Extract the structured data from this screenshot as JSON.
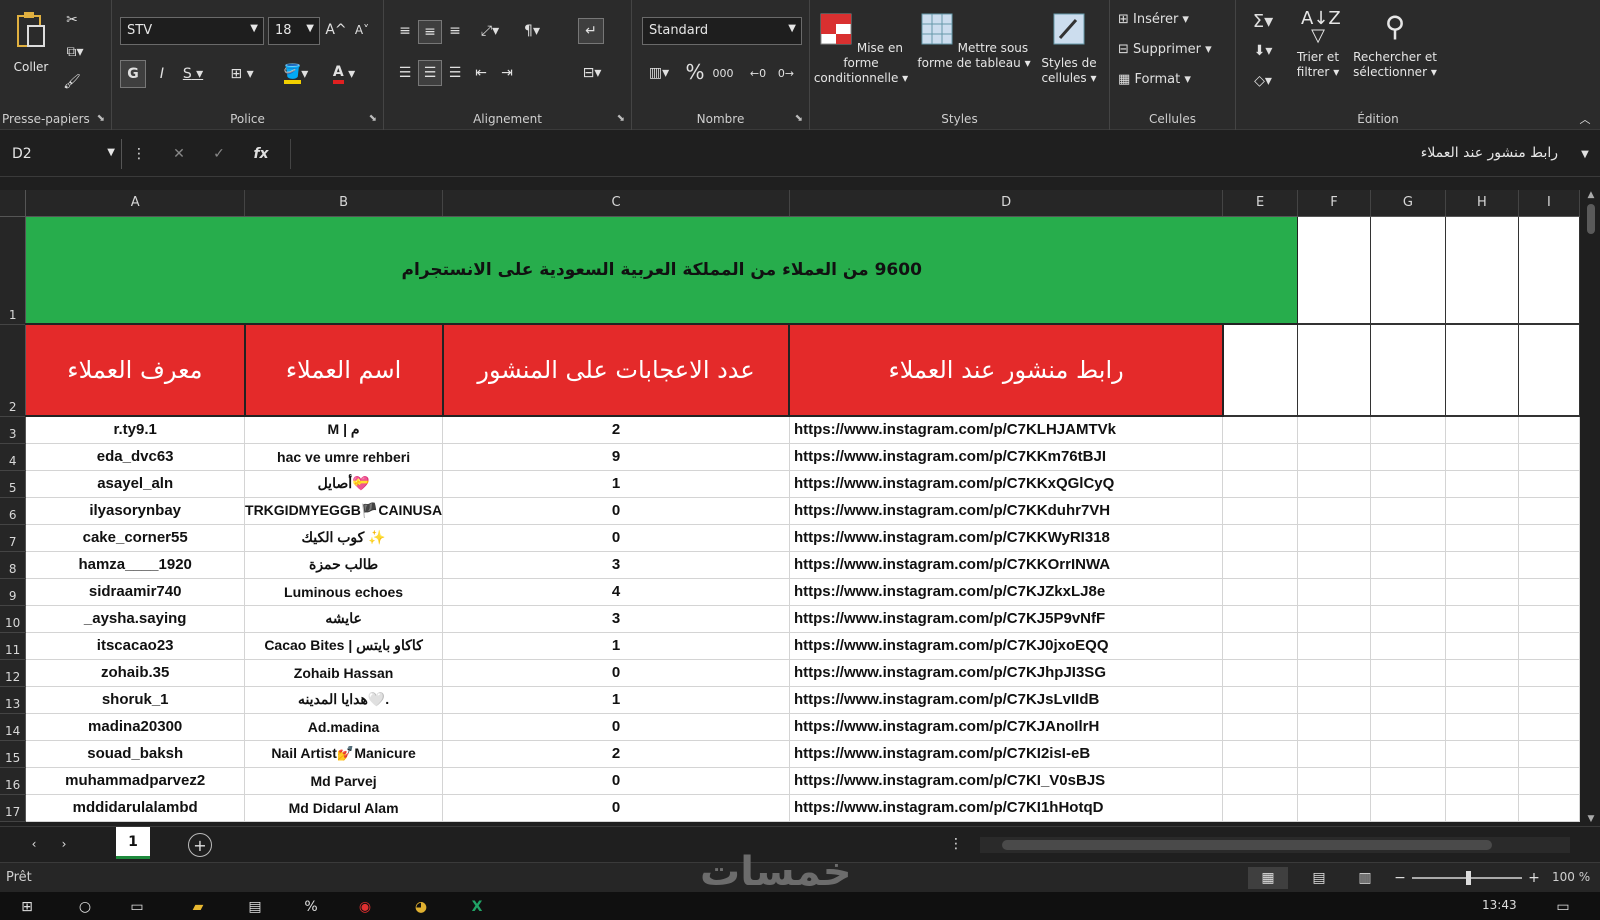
{
  "ribbon": {
    "clipboard": {
      "label": "Presse-papiers",
      "paste": "Coller"
    },
    "font": {
      "label": "Police",
      "name": "STV",
      "size": "18",
      "bold": "G",
      "italic": "I",
      "underline": "S",
      "grow": "A^",
      "shrink": "A˅"
    },
    "alignment": {
      "label": "Alignement"
    },
    "number": {
      "label": "Nombre",
      "format": "Standard",
      "percent": "%",
      "thousands": "000"
    },
    "styles": {
      "label": "Styles",
      "cond_format": "Mise en forme conditionnelle",
      "format_table": "Mettre sous forme de tableau",
      "cell_styles": "Styles de cellules"
    },
    "cells": {
      "label": "Cellules",
      "insert": "Insérer",
      "delete": "Supprimer",
      "format": "Format"
    },
    "editing": {
      "label": "Édition",
      "sort": "Trier et filtrer",
      "find": "Rechercher et sélectionner"
    }
  },
  "formula_bar": {
    "name_box": "D2",
    "content": "رابط منشور عند العملاء"
  },
  "columns": [
    "A",
    "B",
    "C",
    "D",
    "E",
    "F",
    "G",
    "H",
    "I"
  ],
  "title_row": "9600 من العملاء من المملكة العربية السعودية  على الانستجرام",
  "header_row": [
    "معرف العملاء",
    "اسم العملاء",
    "عدد الاعجابات على المنشور",
    "رابط منشور عند العملاء"
  ],
  "rows": [
    {
      "n": "3",
      "a": "r.ty9.1",
      "b": "M | م",
      "c": "2",
      "d": "https://www.instagram.com/p/C7KLHJAMTVk"
    },
    {
      "n": "4",
      "a": "eda_dvc63",
      "b": "hac ve umre rehberi",
      "c": "9",
      "d": "https://www.instagram.com/p/C7KKm76tBJI"
    },
    {
      "n": "5",
      "a": "asayel_aln",
      "b": "أصايل💝",
      "c": "1",
      "d": "https://www.instagram.com/p/C7KKxQGlCyQ"
    },
    {
      "n": "6",
      "a": "ilyasorynbay",
      "b": "TRKGIDMYEGGB🏴CAINUSA",
      "c": "0",
      "d": "https://www.instagram.com/p/C7KKduhr7VH"
    },
    {
      "n": "7",
      "a": "cake_corner55",
      "b": "كوب الكيك ✨",
      "c": "0",
      "d": "https://www.instagram.com/p/C7KKWyRI318"
    },
    {
      "n": "8",
      "a": "hamza____1920",
      "b": "طالب حمزة",
      "c": "3",
      "d": "https://www.instagram.com/p/C7KKOrrINWA"
    },
    {
      "n": "9",
      "a": "sidraamir740",
      "b": "Luminous echoes",
      "c": "4",
      "d": "https://www.instagram.com/p/C7KJZkxLJ8e"
    },
    {
      "n": "10",
      "a": "_aysha.saying",
      "b": "عايشه",
      "c": "3",
      "d": "https://www.instagram.com/p/C7KJ5P9vNfF"
    },
    {
      "n": "11",
      "a": "itscacao23",
      "b": "Cacao Bites | كاكاو بايتس",
      "c": "1",
      "d": "https://www.instagram.com/p/C7KJ0jxoEQQ"
    },
    {
      "n": "12",
      "a": "zohaib.35",
      "b": "Zohaib Hassan",
      "c": "0",
      "d": "https://www.instagram.com/p/C7KJhpJI3SG"
    },
    {
      "n": "13",
      "a": "shoruk_1",
      "b": "هدايا المدينه🤍.",
      "c": "1",
      "d": "https://www.instagram.com/p/C7KJsLvIIdB"
    },
    {
      "n": "14",
      "a": "madina20300",
      "b": "Ad.madina",
      "c": "0",
      "d": "https://www.instagram.com/p/C7KJAnoIlrH"
    },
    {
      "n": "15",
      "a": "souad_baksh",
      "b": "Nail Artist💅Manicure",
      "c": "2",
      "d": "https://www.instagram.com/p/C7KI2isI-eB"
    },
    {
      "n": "16",
      "a": "muhammadparvez2",
      "b": "Md Parvej",
      "c": "0",
      "d": "https://www.instagram.com/p/C7KI_V0sBJS"
    },
    {
      "n": "17",
      "a": "mddidarulalambd",
      "b": "Md Didarul Alam",
      "c": "0",
      "d": "https://www.instagram.com/p/C7KI1hHotqD"
    }
  ],
  "sheet_tab": "1",
  "status": {
    "ready": "Prêt",
    "zoom": "100 %",
    "time": "13:43"
  },
  "watermark": "خمسات"
}
